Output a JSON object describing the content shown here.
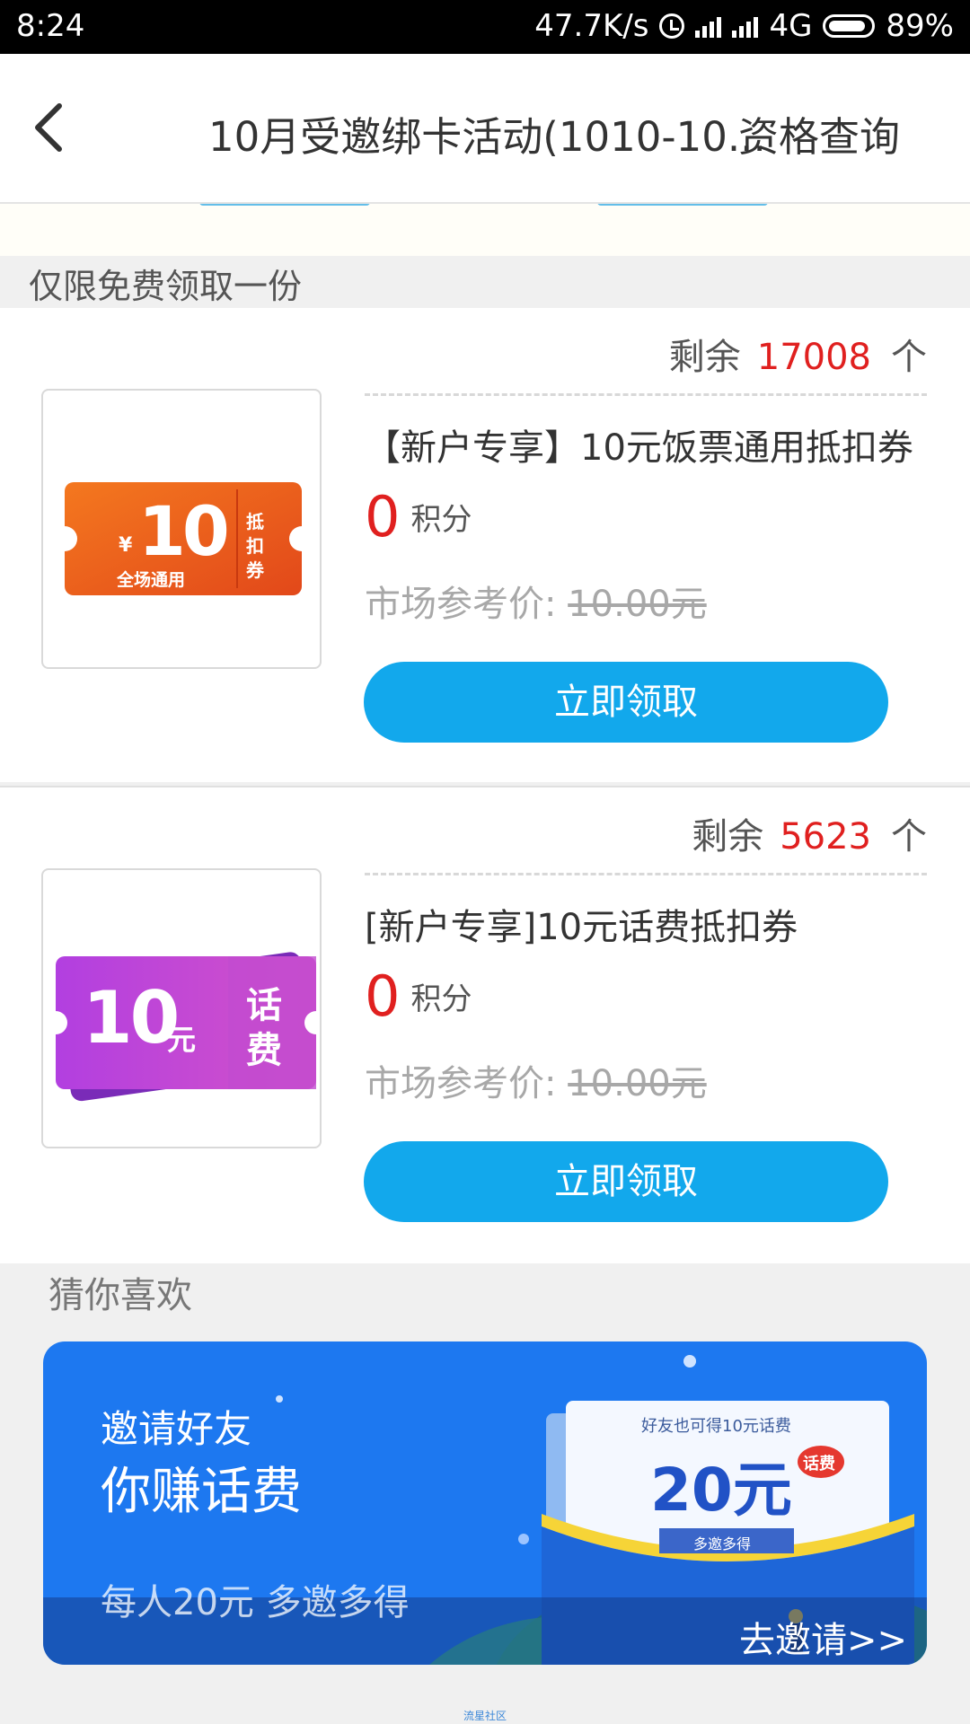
{
  "status_bar": {
    "time": "8:24",
    "net_speed": "47.7K/s",
    "network": "4G",
    "battery": "89%"
  },
  "header": {
    "title": "10月受邀绑卡活动(1010-10...",
    "action": "资格查询"
  },
  "section": {
    "title": "仅限免费领取一份"
  },
  "items": [
    {
      "remain_label": "剩余",
      "remain_count": "17008",
      "remain_unit": "个",
      "name": "【新户专享】10元饭票通用抵扣券",
      "points": "0",
      "points_unit": "积分",
      "ref_label": "市场参考价:",
      "ref_price": "10.00元",
      "button": "立即领取",
      "coupon": {
        "currency": "¥",
        "amount": "10",
        "sub": "全场通用",
        "side": [
          "抵",
          "扣",
          "券"
        ]
      }
    },
    {
      "remain_label": "剩余",
      "remain_count": "5623",
      "remain_unit": "个",
      "name": "[新户专享]10元话费抵扣券",
      "points": "0",
      "points_unit": "积分",
      "ref_label": "市场参考价:",
      "ref_price": "10.00元",
      "button": "立即领取",
      "coupon": {
        "amount": "10",
        "unit": "元",
        "side": [
          "话",
          "费"
        ]
      }
    }
  ],
  "guess": {
    "title": "猜你喜欢",
    "banner": {
      "line1": "邀请好友",
      "line2": "你赚话费",
      "line3": "每人20元 多邀多得",
      "card_top": "好友也可得10元话费",
      "card_amount": "20元",
      "card_badge": "话费",
      "card_bottom": "多邀多得",
      "link": "去邀请>>"
    }
  },
  "footer": {
    "watermark": "流星社区"
  },
  "colors": {
    "accent": "#12a8ec",
    "price_red": "#e0201f",
    "coupon_orange": "#ee5a1c",
    "coupon_purple": "#b13ad9",
    "banner_blue": "#1d78f0"
  }
}
